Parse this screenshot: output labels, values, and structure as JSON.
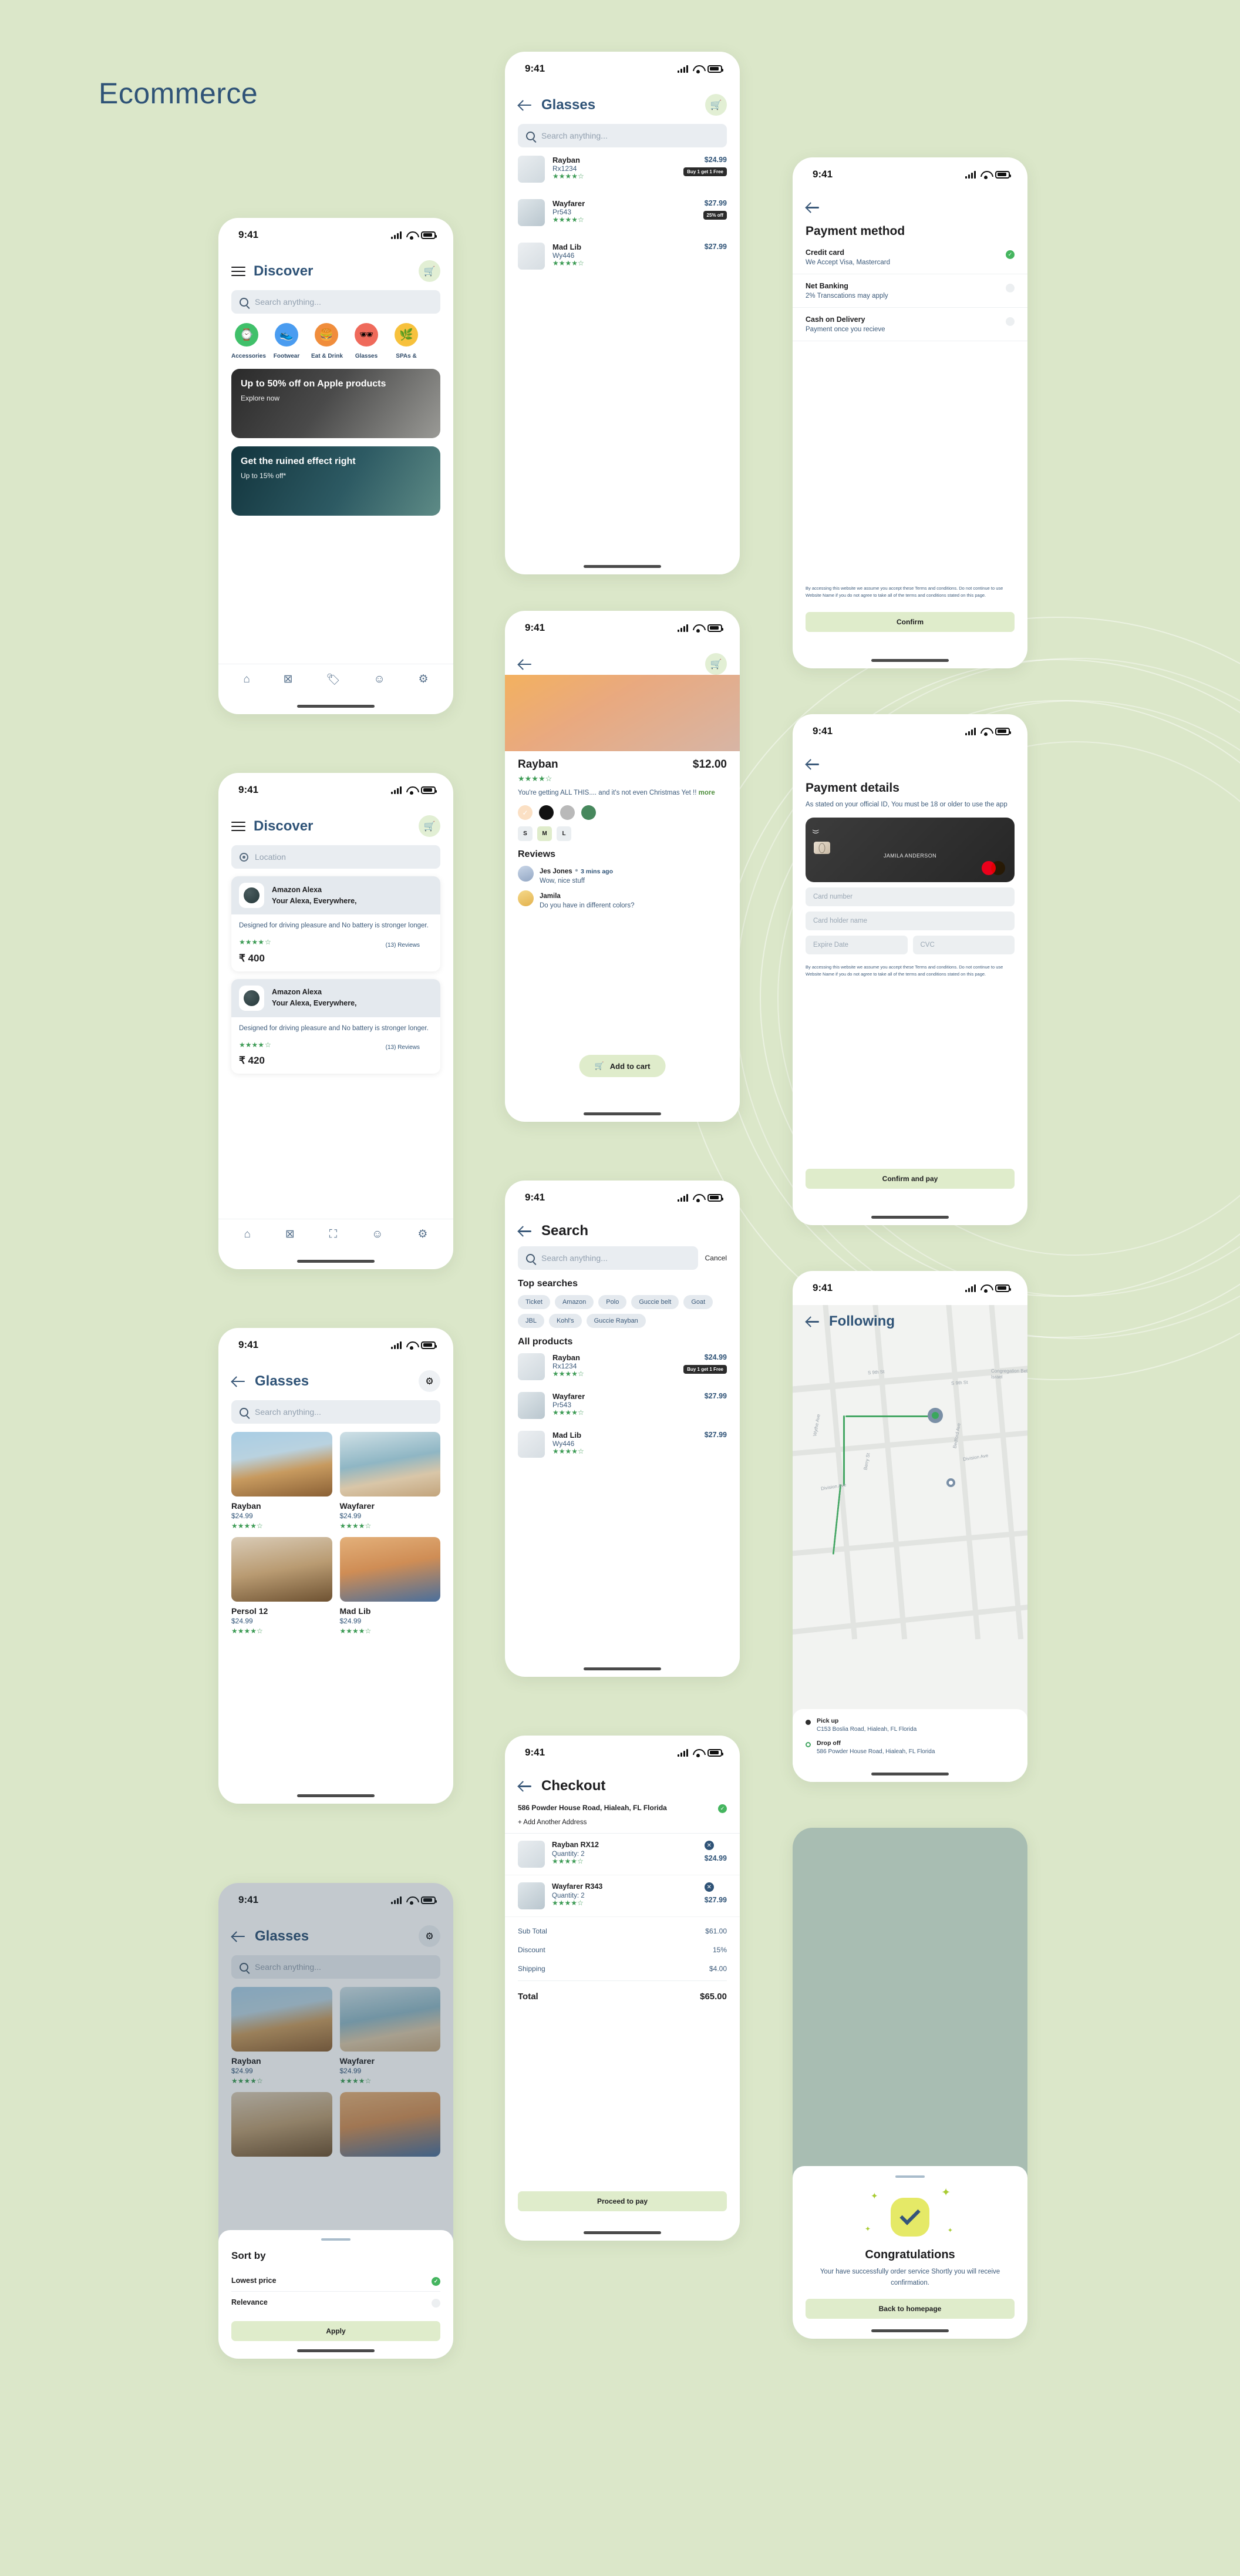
{
  "page": {
    "title": "Ecommerce"
  },
  "status_bar": {
    "time": "9:41"
  },
  "common": {
    "search_placeholder": "Search anything...",
    "location_placeholder": "Location",
    "back_icon": "back-arrow",
    "cart_icon": "shopping-cart",
    "filter_icon": "sliders"
  },
  "screens": {
    "discover": {
      "title": "Discover",
      "categories": [
        {
          "label": "Accessories",
          "icon": "watch",
          "color": "#40c06a"
        },
        {
          "label": "Footwear",
          "icon": "shoe",
          "color": "#4a9cf0"
        },
        {
          "label": "Eat & Drink",
          "icon": "burger",
          "color": "#f08d3c"
        },
        {
          "label": "Glasses",
          "icon": "sunglasses",
          "color": "#ef6a5b"
        },
        {
          "label": "SPAs &",
          "icon": "spa",
          "color": "#f7c13c"
        }
      ],
      "banners": [
        {
          "title": "Up to 50% off on Apple products",
          "subtitle": "Explore now"
        },
        {
          "title": "Get the ruined effect right",
          "subtitle": "Up to 15% off*"
        }
      ],
      "tabs": [
        "home",
        "grid",
        "tag",
        "profile",
        "settings"
      ]
    },
    "discover_location": {
      "title": "Discover",
      "cards": [
        {
          "name": "Amazon Alexa",
          "tagline": "Your Alexa, Everywhere,",
          "description": "Designed for driving pleasure and No battery is stronger longer.",
          "rating": 4,
          "reviews": "(13) Reviews",
          "price": "₹ 400"
        },
        {
          "name": "Amazon Alexa",
          "tagline": "Your Alexa, Everywhere,",
          "description": "Designed for driving pleasure and No battery is stronger longer.",
          "rating": 4,
          "reviews": "(13) Reviews",
          "price": "₹ 420"
        }
      ],
      "tabs": [
        "home",
        "grid",
        "scan",
        "profile",
        "settings"
      ]
    },
    "glasses_grid": {
      "title": "Glasses",
      "products": [
        {
          "name": "Rayban",
          "price": "$24.99",
          "rating": 4
        },
        {
          "name": "Wayfarer",
          "price": "$24.99",
          "rating": 4
        },
        {
          "name": "Persol 12",
          "price": "$24.99",
          "rating": 4
        },
        {
          "name": "Mad Lib",
          "price": "$24.99",
          "rating": 4
        }
      ]
    },
    "sort_sheet": {
      "title": "Sort by",
      "options": [
        {
          "label": "Lowest price",
          "selected": true
        },
        {
          "label": "Relevance",
          "selected": false
        }
      ],
      "apply_label": "Apply"
    },
    "glasses_list": {
      "title": "Glasses",
      "products": [
        {
          "name": "Rayban",
          "code": "Rx1234",
          "price": "$24.99",
          "rating": 4,
          "tag": "Buy 1 get 1 Free"
        },
        {
          "name": "Wayfarer",
          "code": "Pr543",
          "price": "$27.99",
          "rating": 4,
          "tag": "25% off"
        },
        {
          "name": "Mad Lib",
          "code": "Wy446",
          "price": "$27.99",
          "rating": 4,
          "tag": ""
        }
      ]
    },
    "product_detail": {
      "name": "Rayban",
      "price": "$12.00",
      "rating": 4,
      "description": "You're getting ALL THIS.... and it's not even Christmas Yet !!",
      "more_label": "more",
      "colors": [
        "#fbe0c4",
        "#111111",
        "#b9b9b9",
        "#47885d"
      ],
      "sizes": [
        "S",
        "M",
        "L"
      ],
      "selected_size": "M",
      "reviews_title": "Reviews",
      "reviews": [
        {
          "author": "Jes Jones",
          "time": "3 mins ago",
          "comment": "Wow, nice stuff"
        },
        {
          "author": "Jamila",
          "time": "",
          "comment": "Do you have in different colors?"
        }
      ],
      "add_to_cart_label": "Add to cart"
    },
    "search": {
      "title": "Search",
      "cancel_label": "Cancel",
      "top_searches_title": "Top searches",
      "top_searches": [
        "Ticket",
        "Amazon",
        "Polo",
        "Guccie belt",
        "Goat",
        "JBL",
        "Kohl's",
        "Guccie Rayban"
      ],
      "all_products_title": "All products",
      "products": [
        {
          "name": "Rayban",
          "code": "Rx1234",
          "price": "$24.99",
          "rating": 4,
          "tag": "Buy 1 get 1 Free"
        },
        {
          "name": "Wayfarer",
          "code": "Pr543",
          "price": "$27.99",
          "rating": 4,
          "tag": ""
        },
        {
          "name": "Mad Lib",
          "code": "Wy446",
          "price": "$27.99",
          "rating": 4,
          "tag": ""
        }
      ]
    },
    "checkout": {
      "title": "Checkout",
      "address": "586  Powder House Road, Hialeah, FL Florida",
      "add_address_label": "+  Add Another Address",
      "items": [
        {
          "name": "Rayban  RX12",
          "quantity": "Quantity: 2",
          "price": "$24.99",
          "rating": 4
        },
        {
          "name": "Wayfarer R343",
          "quantity": "Quantity: 2",
          "price": "$27.99",
          "rating": 4
        }
      ],
      "summary": [
        {
          "label": "Sub Total",
          "value": "$61.00"
        },
        {
          "label": "Discount",
          "value": "15%"
        },
        {
          "label": "Shipping",
          "value": "$4.00"
        }
      ],
      "total_label": "Total",
      "total_value": "$65.00",
      "cta_label": "Proceed to pay"
    },
    "payment_method": {
      "title": "Payment method",
      "options": [
        {
          "label": "Credit card",
          "hint": "We Accept Visa, Mastercard",
          "selected": true
        },
        {
          "label": "Net Banking",
          "hint": "2% Transcations may apply",
          "selected": false
        },
        {
          "label": "Cash on Delivery",
          "hint": "Payment once you recieve",
          "selected": false
        }
      ],
      "terms": "By accessing this website we assume you accept these Terms and conditions. Do not continue to use Website Name if you do not agree to take all of the terms and conditions stated on this page.",
      "terms_link": "Terms and conditions",
      "cta_label": "Confirm"
    },
    "payment_details": {
      "title": "Payment details",
      "subtitle": "As stated on your official ID, You must be 18 or older to use the app",
      "card": {
        "holder": "JAMILA ANDERSON",
        "brand": "mastercard"
      },
      "fields": [
        {
          "placeholder": "Card number"
        },
        {
          "placeholder": "Card holder name"
        },
        {
          "placeholder": "Expire Date"
        },
        {
          "placeholder": "CVC"
        }
      ],
      "terms": "By accessing this website we assume you accept these Terms and conditions. Do not continue to use Website Name if you do not agree to take all of the terms and conditions stated on this page.",
      "terms_link": "Terms and conditions",
      "cta_label": "Confirm and pay"
    },
    "following": {
      "title": "Following",
      "map_labels": [
        "S 9th St",
        "S 9th St",
        "Wythe Ave",
        "Berry St",
        "Bedford Ave",
        "Division Ave",
        "Division Ave",
        "Congregation Beth Israel"
      ],
      "pickup_label": "Pick up",
      "pickup_value": "C153  Boslia Road, Hialeah, FL Florida",
      "dropoff_label": "Drop off",
      "dropoff_value": "586  Powder House Road, Hialeah, FL Florida"
    },
    "congratulations": {
      "title": "Congratulations",
      "message": "Your have successfully order service Shortly you will receive confirmation.",
      "cta_label": "Back to homepage"
    }
  }
}
